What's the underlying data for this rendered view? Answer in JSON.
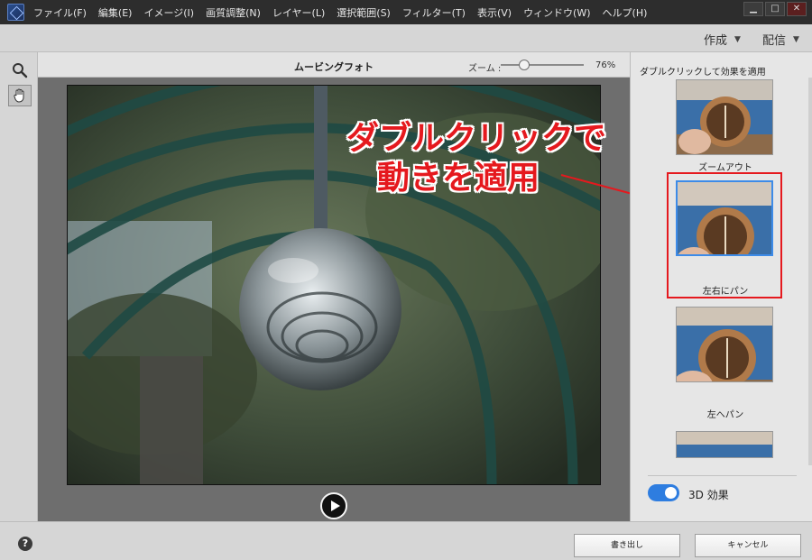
{
  "menu": {
    "items": [
      "ファイル(F)",
      "編集(E)",
      "イメージ(I)",
      "画質調整(N)",
      "レイヤー(L)",
      "選択範囲(S)",
      "フィルター(T)",
      "表示(V)",
      "ウィンドウ(W)",
      "ヘルプ(H)"
    ]
  },
  "window_controls": {
    "minimize": "▁",
    "maximize": "□",
    "close": "✕"
  },
  "subbar": {
    "create": "作成",
    "share": "配信"
  },
  "editor": {
    "title": "ムービングフォト",
    "zoom_label": "ズーム :",
    "zoom_value": "76%",
    "zoom_level_fraction": 0.3
  },
  "annotation": {
    "line1": "ダブルクリックで",
    "line2": "動きを適用"
  },
  "panel": {
    "header": "ダブルクリックして効果を適用",
    "effects": [
      {
        "label": "ズームアウト"
      },
      {
        "label": "左右にパン"
      },
      {
        "label": "左へパン"
      }
    ],
    "toggle_label": "3D 効果",
    "toggle_on": true
  },
  "footer": {
    "help": "?",
    "export": "書き出し",
    "cancel": "キャンセル"
  },
  "colors": {
    "accent": "#2e7de0",
    "annotation_red": "#e5191e",
    "menubar": "#2d2d2d"
  }
}
